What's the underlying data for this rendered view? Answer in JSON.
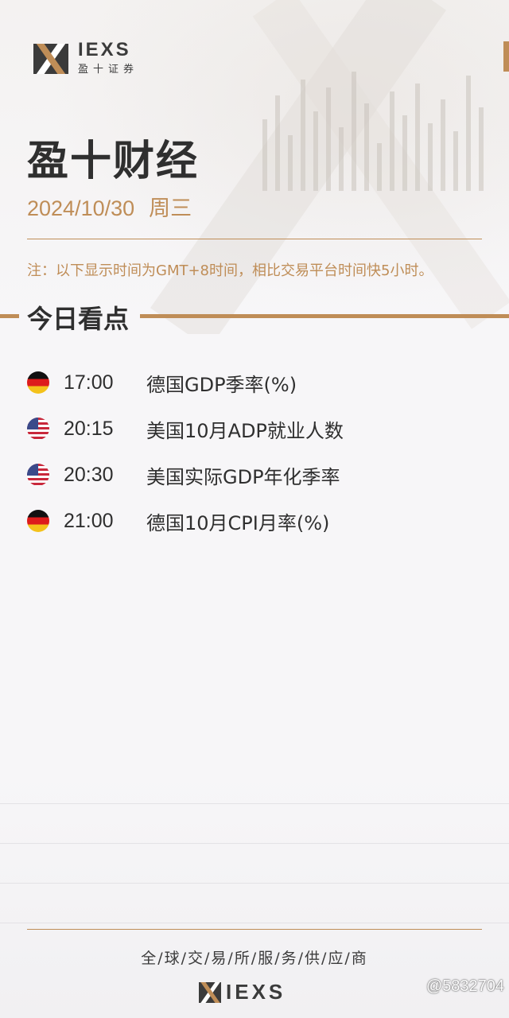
{
  "brand": {
    "logo_en": "IEXS",
    "logo_cn": "盈十证券",
    "accent_color": "#bf8d57"
  },
  "header": {
    "title": "盈十财经",
    "date": "2024/10/30",
    "weekday": "周三",
    "note": "注：以下显示时间为GMT+8时间，相比交易平台时间快5小时。"
  },
  "section": {
    "title": "今日看点"
  },
  "events": [
    {
      "flag": "germany-flag-icon",
      "time": "17:00",
      "name": "德国GDP季率(%)"
    },
    {
      "flag": "usa-flag-icon",
      "time": "20:15",
      "name": "美国10月ADP就业人数"
    },
    {
      "flag": "usa-flag-icon",
      "time": "20:30",
      "name": "美国实际GDP年化季率"
    },
    {
      "flag": "germany-flag-icon",
      "time": "21:00",
      "name": "德国10月CPI月率(%)"
    }
  ],
  "footer": {
    "tagline": "全/球/交/易/所/服/务/供/应/商",
    "logo_en": "IEXS",
    "watermark": "@5832704"
  }
}
